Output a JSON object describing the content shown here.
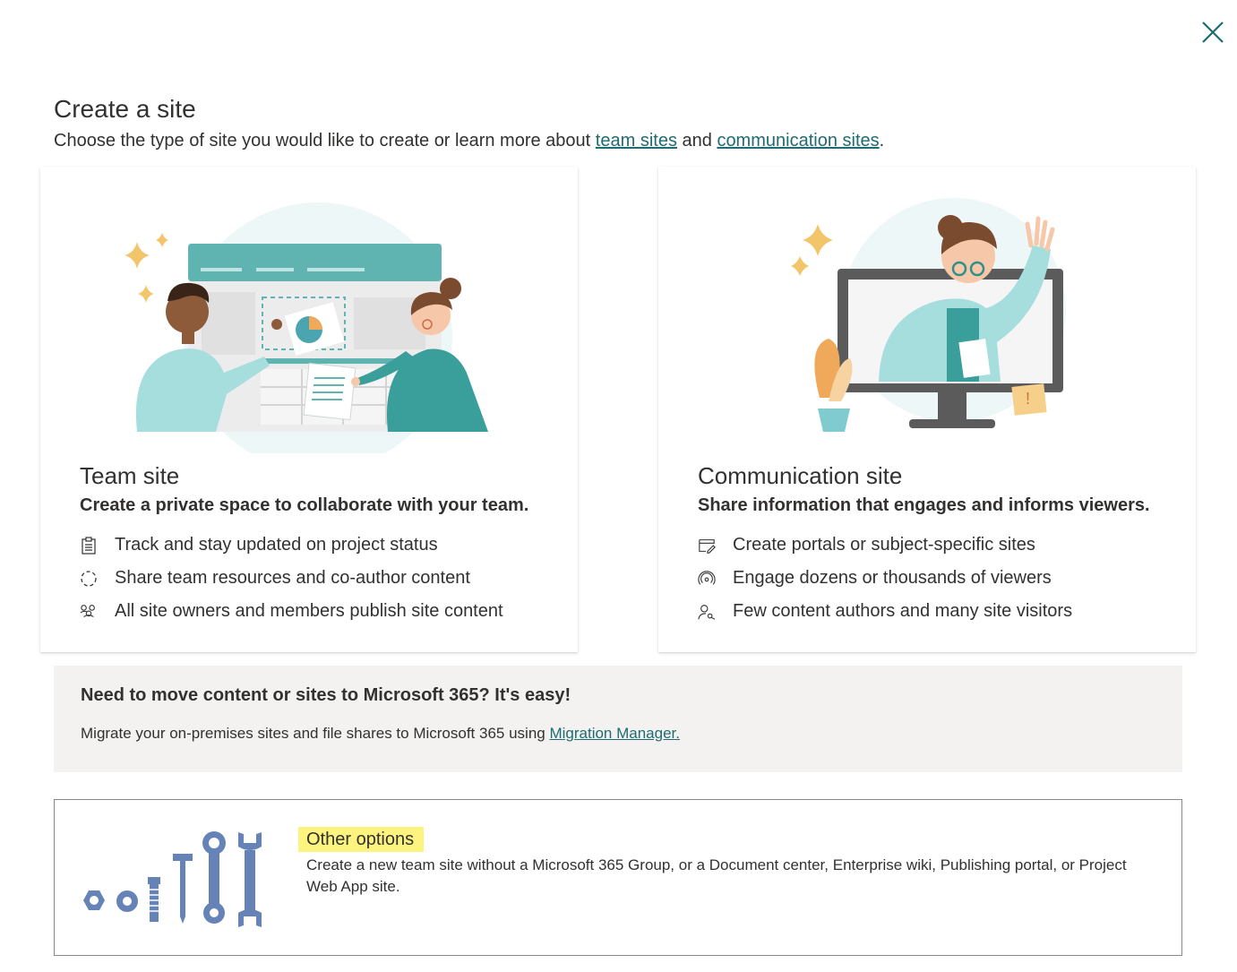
{
  "dialog": {
    "close_icon": "close-icon",
    "title": "Create a site",
    "subtitle_prefix": "Choose the type of site you would like to create or learn more about ",
    "link_team": "team sites",
    "subtitle_and": " and ",
    "link_comm": "communication sites",
    "subtitle_suffix": "."
  },
  "team_card": {
    "title": "Team site",
    "tagline": "Create a private space to collaborate with your team.",
    "features": [
      {
        "icon": "clipboard-icon",
        "text": "Track and stay updated on project status"
      },
      {
        "icon": "sync-icon",
        "text": "Share team resources and co-author content"
      },
      {
        "icon": "people-icon",
        "text": "All site owners and members publish site content"
      }
    ]
  },
  "comm_card": {
    "title": "Communication site",
    "tagline": "Share information that engages and informs viewers.",
    "features": [
      {
        "icon": "edit-page-icon",
        "text": "Create portals or subject-specific sites"
      },
      {
        "icon": "broadcast-icon",
        "text": "Engage dozens or thousands of viewers"
      },
      {
        "icon": "person-key-icon",
        "text": "Few content authors and many site visitors"
      }
    ]
  },
  "migration": {
    "title": "Need to move content or sites to Microsoft 365? It's easy!",
    "text": "Migrate your on-premises sites and file shares to Microsoft 365 using ",
    "link": "Migration Manager."
  },
  "other_options": {
    "title": "Other options",
    "description": "Create a new team site without a Microsoft 365 Group, or a Document center, Enterprise wiki, Publishing portal, or Project Web App site."
  },
  "colors": {
    "accent_teal": "#1e6c70",
    "illustration_teal": "#5fb3b0",
    "highlight": "#fdf480",
    "tools_blue": "#6683b7"
  }
}
